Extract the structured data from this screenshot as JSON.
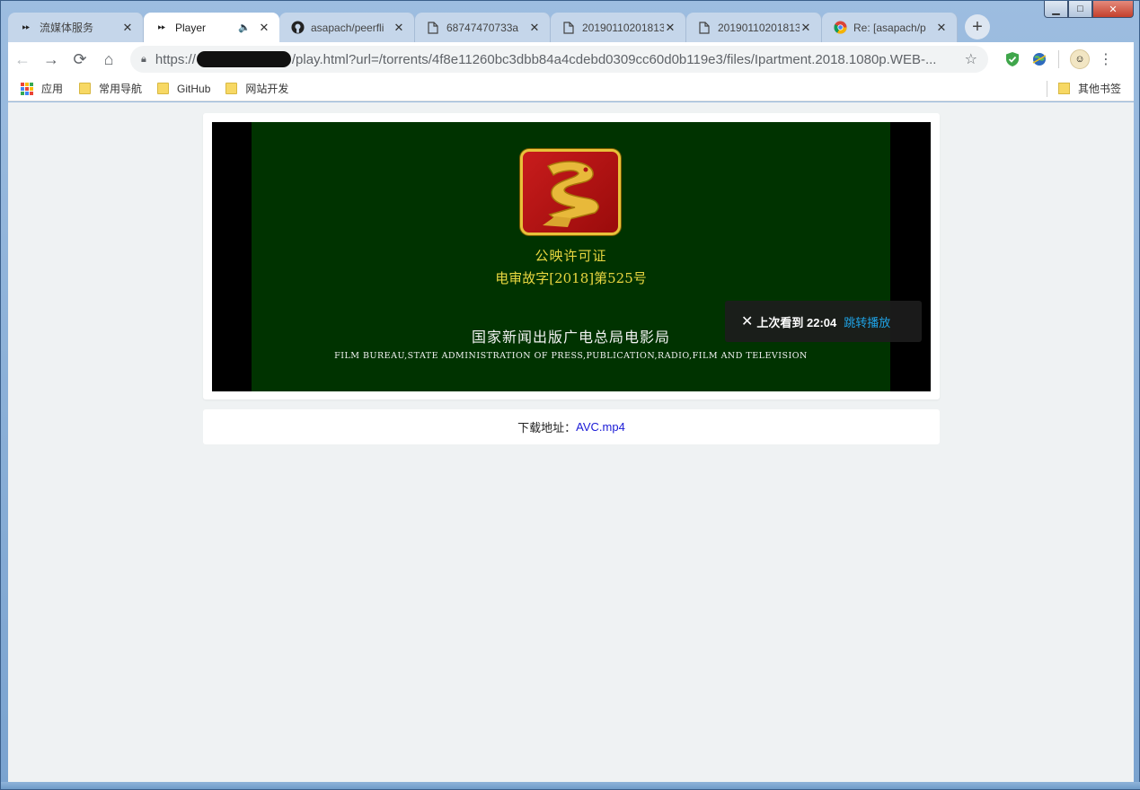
{
  "window": {
    "controls": {
      "minimize": "▁",
      "maximize": "□",
      "close": "✕"
    }
  },
  "tabs": [
    {
      "title": "流媒体服务",
      "icon": "fast-forward-icon",
      "active": false,
      "close": "✕"
    },
    {
      "title": "Player",
      "icon": "fast-forward-icon",
      "active": true,
      "close": "✕",
      "speaker": "🔈"
    },
    {
      "title": "asapach/peerfli",
      "icon": "github-icon",
      "active": false,
      "close": "✕"
    },
    {
      "title": "68747470733a",
      "icon": "file-icon",
      "active": false,
      "close": "✕"
    },
    {
      "title": "20190110201813",
      "icon": "file-icon",
      "active": false,
      "close": "✕"
    },
    {
      "title": "20190110201813",
      "icon": "file-icon",
      "active": false,
      "close": "✕"
    },
    {
      "title": "Re: [asapach/p",
      "icon": "chrome-icon",
      "active": false,
      "close": "✕"
    }
  ],
  "new_tab_label": "+",
  "toolbar": {
    "back": "←",
    "forward": "→",
    "reload": "⟳",
    "home": "⌂",
    "url_scheme": "https://",
    "url_visible_fragment": "",
    "url_path": "/play.html?url=/torrents/4f8e11260bc3dbb84a4cdebd0309cc60d0b119e3/files/Ipartment.2018.1080p.WEB-...",
    "star": "☆",
    "menu": "⋮"
  },
  "bookmarks": {
    "apps_label": "应用",
    "items": [
      "常用导航",
      "GitHub",
      "网站开发"
    ],
    "other_label": "其他书签"
  },
  "player": {
    "license_line1": "公映许可证",
    "license_line2": "电审故字[2018]第525号",
    "bureau_cn": "国家新闻出版广电总局电影局",
    "bureau_en": "FILM BUREAU,STATE ADMINISTRATION OF PRESS,PUBLICATION,RADIO,FILM AND TELEVISION",
    "resume": {
      "close": "✕",
      "text": "上次看到 22:04",
      "jump_label": "跳转播放"
    }
  },
  "download": {
    "label": "下载地址：",
    "link_text": "AVC.mp4"
  },
  "colors": {
    "page_bg": "#eff2f3",
    "video_frame": "#003300",
    "license_text": "#e8d640",
    "jump_link": "#1fa3e6",
    "download_link": "#1a1ad6"
  }
}
